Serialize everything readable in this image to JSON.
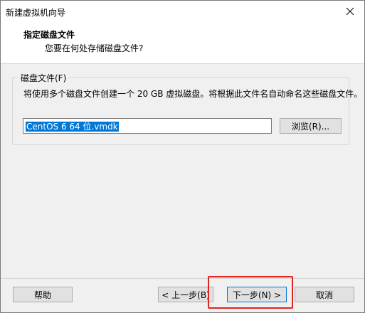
{
  "window": {
    "title": "新建虚拟机向导",
    "close_icon": "close-icon"
  },
  "header": {
    "title": "指定磁盘文件",
    "subtitle": "您要在何处存储磁盘文件?"
  },
  "disk_group": {
    "legend": "磁盘文件(F)",
    "description": "将使用多个磁盘文件创建一个 20 GB 虚拟磁盘。将根据此文件名自动命名这些磁盘文件。",
    "file_value": "CentOS 6 64 位.vmdk",
    "browse_label": "浏览(R)..."
  },
  "footer": {
    "help_label": "帮助",
    "back_label": "< 上一步(B)",
    "next_label": "下一步(N) >",
    "cancel_label": "取消",
    "highlight_color": "#e0241f"
  }
}
